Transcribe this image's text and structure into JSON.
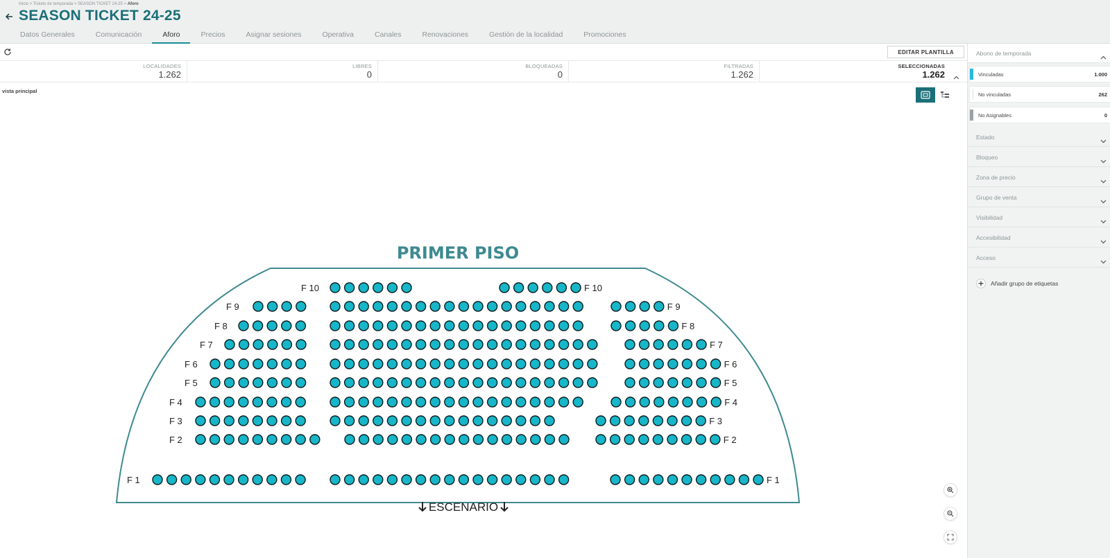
{
  "breadcrumb": {
    "path": "Inicio > Tickets de temporada > SEASON TICKET 24-25 > ",
    "current": "Aforo"
  },
  "title": "SEASON TICKET 24-25",
  "tabs": [
    {
      "label": "Datos Generales",
      "active": false
    },
    {
      "label": "Comunicación",
      "active": false
    },
    {
      "label": "Aforo",
      "active": true
    },
    {
      "label": "Precios",
      "active": false
    },
    {
      "label": "Asignar sesiones",
      "active": false
    },
    {
      "label": "Operativa",
      "active": false
    },
    {
      "label": "Canales",
      "active": false
    },
    {
      "label": "Renovaciones",
      "active": false
    },
    {
      "label": "Gestión de la localidad",
      "active": false
    },
    {
      "label": "Promociones",
      "active": false
    }
  ],
  "toolbar": {
    "edit_label": "EDITAR PLANTILLA"
  },
  "stats": [
    {
      "label": "LOCALIDADES",
      "value": "1.262"
    },
    {
      "label": "LIBRES",
      "value": "0"
    },
    {
      "label": "BLOQUEADAS",
      "value": "0"
    },
    {
      "label": "FILTRADAS",
      "value": "1.262"
    },
    {
      "label": "SELECCIONADAS",
      "value": "1.262"
    }
  ],
  "view_label": "vista principal",
  "map": {
    "title": "PRIMER PISO",
    "stage_label": "ESCENARIO",
    "seat_color": "#17b6c9",
    "outline_color": "#3e8a90",
    "rows": [
      {
        "label": "F 10",
        "left_label": "F 10",
        "right_label": "F 10",
        "blocks": [
          6,
          6
        ],
        "hide_left_block": true
      },
      {
        "label": "F 9",
        "left_label": "F 9",
        "right_label": "F 9",
        "blocks": [
          4,
          18,
          4
        ]
      },
      {
        "label": "F 8",
        "left_label": "F 8",
        "right_label": "F 8",
        "blocks": [
          5,
          18,
          5
        ]
      },
      {
        "label": "F 7",
        "left_label": "F 7",
        "right_label": "F 7",
        "blocks": [
          6,
          19,
          6
        ]
      },
      {
        "label": "F 6",
        "left_label": "F 6",
        "right_label": "F 6",
        "blocks": [
          7,
          19,
          7
        ]
      },
      {
        "label": "F 5",
        "left_label": "F 5",
        "right_label": "F 5",
        "blocks": [
          7,
          19,
          7
        ]
      },
      {
        "label": "F 4",
        "left_label": "F 4",
        "right_label": "F 4",
        "blocks": [
          8,
          18,
          8
        ]
      },
      {
        "label": "F 3",
        "left_label": "F 3",
        "right_label": "F 3",
        "blocks": [
          8,
          16,
          8
        ]
      },
      {
        "label": "F 2",
        "left_label": "F 2",
        "right_label": "F 2",
        "blocks": [
          9,
          16,
          9
        ]
      },
      {
        "label": "F 1",
        "left_label": "F 1",
        "right_label": "F 1",
        "blocks": [
          11,
          17,
          11
        ]
      }
    ]
  },
  "sidebar": {
    "header": "Abono de temporada",
    "legend": [
      {
        "label": "Vinculadas",
        "value": "1.000",
        "color": "#2bb7e0"
      },
      {
        "label": "No vinculadas",
        "value": "262",
        "color": "#ffffff"
      },
      {
        "label": "No Asignables",
        "value": "0",
        "color": "#9aa3a3"
      }
    ],
    "sections": [
      {
        "label": "Estado"
      },
      {
        "label": "Bloqueo"
      },
      {
        "label": "Zona de precio"
      },
      {
        "label": "Grupo de venta"
      },
      {
        "label": "Visibilidad"
      },
      {
        "label": "Accesibilidad"
      },
      {
        "label": "Acceso"
      }
    ],
    "add_group_label": "Añadir grupo de etiquetas"
  }
}
